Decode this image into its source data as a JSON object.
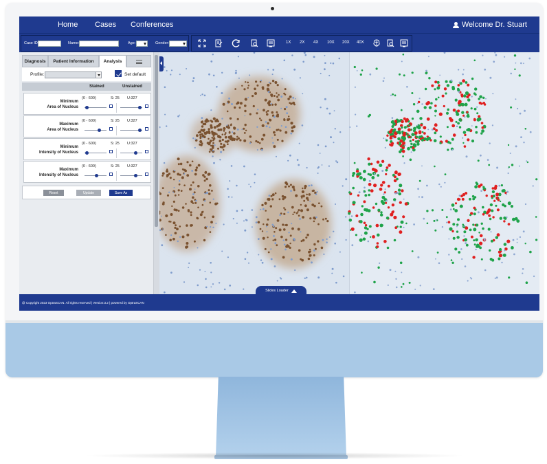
{
  "nav": {
    "home": "Home",
    "cases": "Cases",
    "conferences": "Conferences",
    "welcome": "Welcome Dr. Stuart"
  },
  "toolbar": {
    "case_id_label": "Case ID:",
    "name_label": "Name:",
    "age_label": "Age:",
    "gender_label": "Gender:",
    "zoom_levels": [
      "1X",
      "2X",
      "4X",
      "10X",
      "20X",
      "40X"
    ],
    "icons": [
      "fit-screen-icon",
      "annotate-icon",
      "refresh-icon",
      "zoom-search-icon",
      "report-icon",
      "brain-icon",
      "search-doc-icon",
      "export-icon"
    ]
  },
  "panel": {
    "tabs": [
      "Diagnosis",
      "Patient Information",
      "Analysis"
    ],
    "active_tab": "Analysis",
    "profile_label": "Profile:",
    "set_default_label": "Set default",
    "set_default_checked": true,
    "col_stained": "Stained",
    "col_unstained": "Unstained",
    "params": [
      {
        "name_1": "Minimum",
        "name_2": "Area of Nucleus",
        "range": "(0 - 600)",
        "s": "S: 25",
        "u": "U:327",
        "stained_level": 0.05,
        "unstained_level": 0.95
      },
      {
        "name_1": "Maximum",
        "name_2": "Area of Nucleus",
        "range": "(0 - 600)",
        "s": "S: 25",
        "u": "U:327",
        "stained_level": 0.7,
        "unstained_level": 0.95
      },
      {
        "name_1": "Minimum",
        "name_2": "Intensity of Nucleus",
        "range": "(0 - 600)",
        "s": "S: 25",
        "u": "U:327",
        "stained_level": 0.05,
        "unstained_level": 0.75
      },
      {
        "name_1": "Maximum",
        "name_2": "Intensity of Nucleus",
        "range": "(0 - 600)",
        "s": "S: 25",
        "u": "U:327",
        "stained_level": 0.55,
        "unstained_level": 0.75
      }
    ],
    "buttons": {
      "reset": "Reset",
      "update": "Update",
      "save_as": "Save As"
    }
  },
  "viewer": {
    "slides_loader": "Slides Loader"
  },
  "footer": {
    "text": "@ Copyright 2023 OptraSCAN. All rights reserved | Version:3.2 | powered by OptraSCAN"
  },
  "colors": {
    "brand": "#1f3a8f",
    "stained": "#7a5230",
    "positive": "#e02020",
    "negative": "#1fa34a"
  }
}
